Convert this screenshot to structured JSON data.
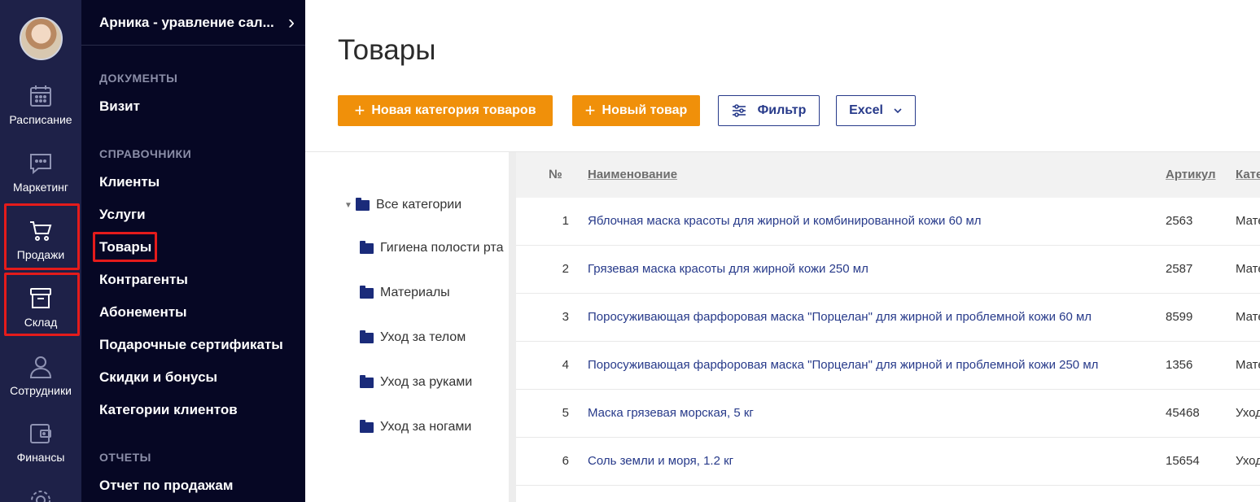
{
  "rail": {
    "items": [
      {
        "label": "Расписание",
        "icon": "calendar-icon"
      },
      {
        "label": "Маркетинг",
        "icon": "chat-icon"
      },
      {
        "label": "Продажи",
        "icon": "cart-icon"
      },
      {
        "label": "Склад",
        "icon": "archive-box-icon"
      },
      {
        "label": "Сотрудники",
        "icon": "user-icon"
      },
      {
        "label": "Финансы",
        "icon": "wallet-icon"
      }
    ],
    "highlight_color": "#e41b1b"
  },
  "menu": {
    "org_name": "Арника - уравление сал...",
    "org_chevron": "›",
    "sections": [
      {
        "title": "ДОКУМЕНТЫ",
        "items": [
          "Визит"
        ]
      },
      {
        "title": "СПРАВОЧНИКИ",
        "items": [
          "Клиенты",
          "Услуги",
          "Товары",
          "Контрагенты",
          "Абонементы",
          "Подарочные сертификаты",
          "Скидки и бонусы",
          "Категории клиентов"
        ]
      },
      {
        "title": "ОТЧЕТЫ",
        "items": [
          "Отчет по продажам"
        ]
      }
    ],
    "active_item": "Товары"
  },
  "page": {
    "title": "Товары",
    "buttons": {
      "new_category": "Новая категория товаров",
      "new_product": "Новый товар",
      "filter": "Фильтр",
      "excel": "Excel"
    },
    "accent_color": "#f0900a",
    "link_color": "#273a8a"
  },
  "tree": {
    "root": "Все категории",
    "items": [
      "Гигиена полости рта",
      "Материалы",
      "Уход за телом",
      "Уход за руками",
      "Уход за ногами"
    ]
  },
  "table": {
    "columns": [
      "№",
      "Наименование",
      "Артикул",
      "Кате"
    ],
    "rows": [
      {
        "num": "1",
        "name": "Яблочная маска красоты для жирной и комбинированной кожи 60 мл",
        "article": "2563",
        "category": "Мате"
      },
      {
        "num": "2",
        "name": "Грязевая маска красоты для жирной кожи 250 мл",
        "article": "2587",
        "category": "Мате"
      },
      {
        "num": "3",
        "name": "Поросуживающая фарфоровая маска \"Порцелан\" для жирной и проблемной кожи 60 мл",
        "article": "8599",
        "category": "Мате"
      },
      {
        "num": "4",
        "name": "Поросуживающая фарфоровая маска \"Порцелан\" для жирной и проблемной кожи 250 мл",
        "article": "1356",
        "category": "Мате"
      },
      {
        "num": "5",
        "name": "Маска грязевая морская, 5 кг",
        "article": "45468",
        "category": "Уход"
      },
      {
        "num": "6",
        "name": "Соль земли и моря, 1.2 кг",
        "article": "15654",
        "category": "Уход"
      }
    ]
  }
}
